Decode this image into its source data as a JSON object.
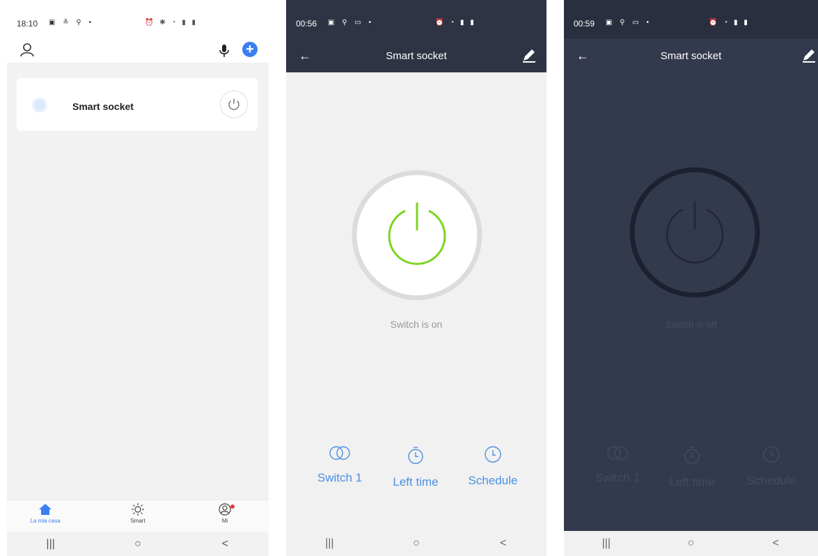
{
  "phone1": {
    "status": {
      "time": "18:10",
      "icons_left": "▣ ≙ ⚲ •",
      "icons_right": "⏰ ✱ ◔ ▮ ▮"
    },
    "device": {
      "name": "Smart socket"
    },
    "tabs": [
      {
        "label": "La mia casa",
        "icon": "home-icon",
        "active": true
      },
      {
        "label": "Smart",
        "icon": "sun-icon",
        "active": false
      },
      {
        "label": "Mi",
        "icon": "profile-icon",
        "active": false
      }
    ],
    "nav": {
      "recents": "|||",
      "home": "○",
      "back": "<"
    }
  },
  "phone2": {
    "status": {
      "time": "00:56",
      "icons_left": "▣ ⚲ ▭ •",
      "icons_right": "⏰ ◔ ▮ ▮"
    },
    "header": {
      "title": "Smart socket",
      "back": "←"
    },
    "power_state": "on",
    "status_text": "Switch is on",
    "actions": [
      {
        "label": "Switch 1",
        "icon": "switch-toggle-icon"
      },
      {
        "label": "Left time",
        "icon": "timer-icon"
      },
      {
        "label": "Schedule",
        "icon": "clock-icon"
      }
    ],
    "nav": {
      "recents": "|||",
      "home": "○",
      "back": "<"
    }
  },
  "phone3": {
    "status": {
      "time": "00:59",
      "icons_left": "▣ ⚲ ▭ •",
      "icons_right": "⏰ ◔ ▮ ▮"
    },
    "header": {
      "title": "Smart socket",
      "back": "←"
    },
    "power_state": "off",
    "status_text": "Switch is off",
    "actions": [
      {
        "label": "Switch 1",
        "icon": "switch-toggle-icon"
      },
      {
        "label": "Left time",
        "icon": "timer-icon"
      },
      {
        "label": "Schedule",
        "icon": "clock-icon"
      }
    ],
    "nav": {
      "recents": "|||",
      "home": "○",
      "back": "<"
    }
  },
  "colors": {
    "accent": "#3b7ff2",
    "action_blue": "#4a90e2",
    "power_on_green": "#7ed321",
    "dark_bg": "#343a4d",
    "header_dark": "#2f3445"
  }
}
